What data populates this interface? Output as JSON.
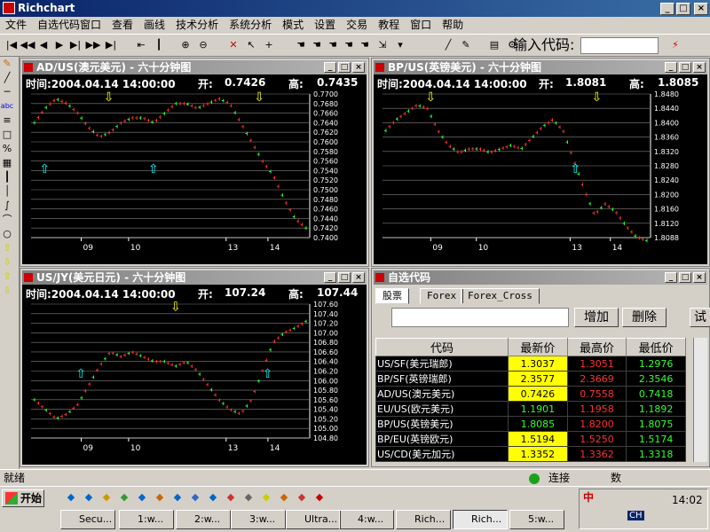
{
  "window": {
    "title": "Richchart",
    "min": "_",
    "max": "□",
    "close": "×"
  },
  "menu": [
    "文件",
    "自选代码窗口",
    "查看",
    "画线",
    "技术分析",
    "系统分析",
    "模式",
    "设置",
    "交易",
    "教程",
    "窗口",
    "帮助"
  ],
  "toolbar": {
    "code_label": "输入代码:",
    "icons": [
      "first-icon",
      "rewind-icon",
      "prev-icon",
      "play-icon",
      "next-icon",
      "fast-forward-icon",
      "last-icon",
      "marker-icon",
      "bars-icon",
      "zoom-in-icon",
      "zoom-out-icon",
      "delete-icon",
      "pointer-icon",
      "crosshair-icon",
      "hand-icon",
      "hand-icon",
      "hand-icon",
      "hand-icon",
      "hand-icon",
      "scroll-icon",
      "dropdown-icon",
      "draw-line-icon",
      "draw-tool-icon",
      "chart-icon",
      "config-icon",
      "close-icon"
    ]
  },
  "lefttools": [
    "pencil-icon",
    "slash-icon",
    "hline-icon",
    "abc-text-icon",
    "lines-icon",
    "rect-icon",
    "fib-icon",
    "grid-icon",
    "bars-icon",
    "vline-icon",
    "curve-icon",
    "arc-icon",
    "ellipse-icon",
    "up-arrow-icon",
    "down-arrow-icon",
    "up-arrow-icon",
    "down-arrow-icon"
  ],
  "charts": [
    {
      "id": "ad",
      "title": "AD/US(澳元美元) - 六十分钟图",
      "time": "时间:2004.04.14 14:00:00",
      "open_label": "开:",
      "open": "0.7426",
      "high_label": "高:",
      "high": "0.7435",
      "yticks": [
        "0.7700",
        "0.7680",
        "0.7660",
        "0.7640",
        "0.7620",
        "0.7600",
        "0.7580",
        "0.7560",
        "0.7540",
        "0.7520",
        "0.7500",
        "0.7480",
        "0.7460",
        "0.7440",
        "0.7420",
        "0.7400"
      ],
      "xticks": [
        "09",
        "10",
        "13",
        "14"
      ],
      "chart_data": {
        "type": "line",
        "x_labels": [
          "09",
          "10",
          "13",
          "14"
        ],
        "series": [
          {
            "values": [
              0.764,
              0.767,
              0.769,
              0.768,
              0.766,
              0.763,
              0.761,
              0.762,
              0.764,
              0.765,
              0.765,
              0.764,
              0.766,
              0.768,
              0.768,
              0.767,
              0.768,
              0.769,
              0.768,
              0.764,
              0.76,
              0.756,
              0.753,
              0.748,
              0.744,
              0.742
            ]
          }
        ],
        "ylim": [
          0.74,
          0.77
        ]
      }
    },
    {
      "id": "bp",
      "title": "BP/US(英镑美元) - 六十分钟图",
      "time": "时间:2004.04.14 14:00:00",
      "open_label": "开:",
      "open": "1.8081",
      "high_label": "高:",
      "high": "1.8085",
      "yticks": [
        "1.8480",
        "1.8440",
        "1.8400",
        "1.8360",
        "1.8320",
        "1.8280",
        "1.8240",
        "1.8200",
        "1.8160",
        "1.8120",
        "1.8088"
      ],
      "xticks": [
        "09",
        "10",
        "13",
        "14"
      ],
      "chart_data": {
        "type": "line",
        "x_labels": [
          "09",
          "10",
          "13",
          "14"
        ],
        "series": [
          {
            "values": [
              1.838,
              1.841,
              1.843,
              1.845,
              1.844,
              1.838,
              1.834,
              1.832,
              1.833,
              1.833,
              1.832,
              1.833,
              1.834,
              1.833,
              1.836,
              1.839,
              1.841,
              1.838,
              1.83,
              1.822,
              1.815,
              1.818,
              1.816,
              1.812,
              1.809,
              1.808
            ]
          }
        ],
        "ylim": [
          1.8088,
          1.848
        ]
      }
    },
    {
      "id": "jy",
      "title": "US/JY(美元日元) - 六十分钟图",
      "time": "时间:2004.04.14 14:00:00",
      "open_label": "开:",
      "open": "107.24",
      "high_label": "高:",
      "high": "107.44",
      "yticks": [
        "107.60",
        "107.40",
        "107.20",
        "107.00",
        "106.80",
        "106.60",
        "106.40",
        "106.20",
        "106.00",
        "105.80",
        "105.60",
        "105.40",
        "105.20",
        "105.00",
        "104.80"
      ],
      "xticks": [
        "09",
        "10",
        "13",
        "14"
      ],
      "chart_data": {
        "type": "line",
        "x_labels": [
          "09",
          "10",
          "13",
          "14"
        ],
        "series": [
          {
            "values": [
              105.6,
              105.4,
              105.2,
              105.3,
              105.5,
              105.9,
              106.3,
              106.6,
              106.5,
              106.6,
              106.5,
              106.4,
              106.4,
              106.3,
              106.4,
              106.2,
              105.9,
              105.6,
              105.4,
              105.3,
              105.6,
              106.2,
              106.8,
              107.0,
              107.1,
              107.24
            ]
          }
        ],
        "ylim": [
          104.8,
          107.6
        ]
      }
    }
  ],
  "watch": {
    "title": "自选代码",
    "tabs": [
      "股票",
      "Forex",
      "Forex_Cross"
    ],
    "add": "增加",
    "del": "删除",
    "more": "试",
    "headers": [
      "代码",
      "最新价",
      "最高价",
      "最低价"
    ],
    "rows": [
      [
        "US/SF(美元瑞郎)",
        "1.3037",
        "1.3051",
        "1.2976"
      ],
      [
        "BP/SF(英镑瑞郎)",
        "2.3577",
        "2.3669",
        "2.3546"
      ],
      [
        "AD/US(澳元美元)",
        "0.7426",
        "0.7558",
        "0.7418"
      ],
      [
        "EU/US(欧元美元)",
        "1.1901",
        "1.1958",
        "1.1892"
      ],
      [
        "BP/US(英镑美元)",
        "1.8085",
        "1.8200",
        "1.8075"
      ],
      [
        "BP/EU(英镑欧元)",
        "1.5194",
        "1.5250",
        "1.5174"
      ],
      [
        "US/CD(美元加元)",
        "1.3352",
        "1.3362",
        "1.3318"
      ]
    ],
    "highlight": [
      true,
      true,
      true,
      false,
      false,
      true,
      true
    ]
  },
  "status": {
    "left": "就绪",
    "connect": "连接",
    "data": "数"
  },
  "taskbar": {
    "start": "开始",
    "tasks": [
      "Secu...",
      "1:w...",
      "2:w...",
      "3:w...",
      "Ultra...",
      "4:w...",
      "Rich...",
      "Rich...",
      "5:w..."
    ],
    "active": 7,
    "time": "14:02",
    "ime": "中",
    "ch": "CH"
  },
  "colors": {
    "up": "#ff3030",
    "down": "#30ff30",
    "accent": "#0a246a"
  }
}
